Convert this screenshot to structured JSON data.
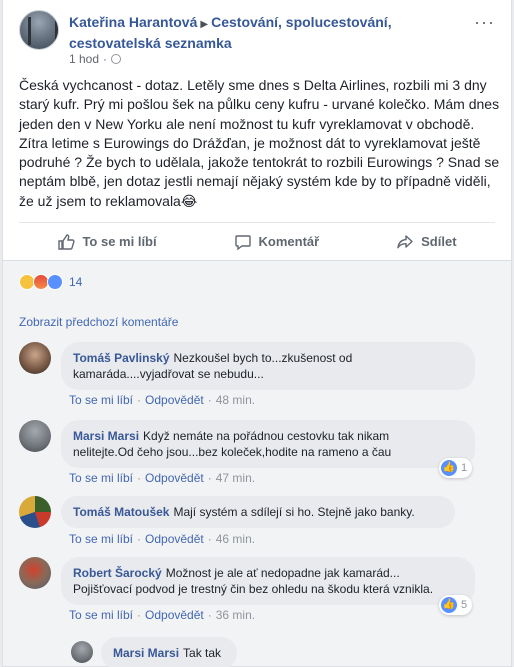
{
  "post": {
    "author": "Kateřina Harantová",
    "group": "Cestování, spolucestování, cestovatelská seznamka",
    "time": "1 hod",
    "more_label": "···",
    "text": "Česká vychcanost - dotaz. Letěly sme dnes s Delta Airlines, rozbili mi 3 dny starý kufr. Prý mi pošlou šek na půlku ceny kufru - urvané kolečko. Mám dnes jeden den v New Yorku ale není možnost tu kufr vyreklamovat v obchodě. Zítra letime s Eurowings do Drážďan, je možnost dát to vyreklamovat ještě podruhé ? Že bych to udělala, jakože tentokrát to rozbili Eurowings ? Snad se neptám blbě, jen dotaz jestli nemají nějaký systém kde by to případně viděli, že už jsem to reklamovala😂"
  },
  "actions": {
    "like": "To se mi líbí",
    "comment": "Komentář",
    "share": "Sdílet"
  },
  "reactions": {
    "icons": [
      "haha-icon",
      "angry-icon",
      "like-icon"
    ],
    "count": "14"
  },
  "comments_section": {
    "prev_link": "Zobrazit předchozí komentáře",
    "like_label": "To se mi líbí",
    "reply_label": "Odpovědět",
    "items": [
      {
        "name": "Tomáš Pavlinský",
        "line1": "Nezkoušel bych to...zkušenost od",
        "line2": "kamaráda....vyjadřovat se nebudu...",
        "time": "48 min."
      },
      {
        "name": "Marsi Marsi",
        "line1": "Když nemáte na pořádnou cestovku tak nikam",
        "line2": "nelitejte.Od čeho jsou...bez koleček,hodite na rameno a čau",
        "time": "47 min.",
        "likes": "1"
      },
      {
        "name": "Tomáš Matoušek",
        "line1": "Mají systém a sdílejí si ho. Stejně jako banky.",
        "time": "46 min."
      },
      {
        "name": "Robert Šarocký",
        "line1": "Možnost je ale ať nedopadne jak kamarád...",
        "line2": "Pojišťovací podvod je trestný čin bez ohledu na škodu která vznikla.",
        "time": "36 min.",
        "likes": "5"
      }
    ],
    "reply": {
      "name": "Marsi Marsi",
      "text": "Tak tak"
    }
  },
  "colors": {
    "link": "#365899",
    "accent": "#4267b2",
    "bubble": "#e8eaed",
    "background": "#f2f3f5"
  }
}
